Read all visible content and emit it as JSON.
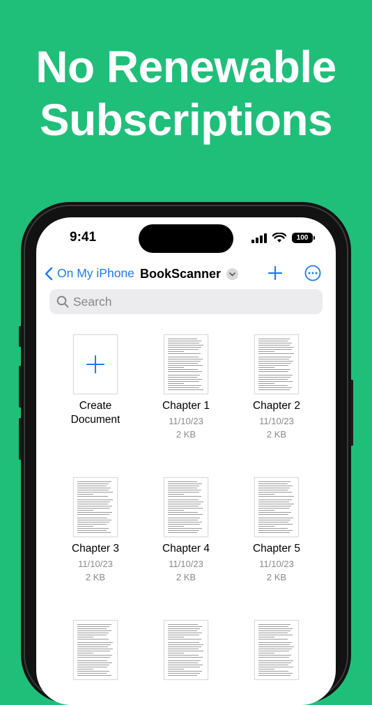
{
  "headline": {
    "line1": "No Renewable",
    "line2": "Subscriptions"
  },
  "status_bar": {
    "time": "9:41",
    "battery": "100"
  },
  "nav": {
    "back_label": "On My iPhone",
    "title": "BookScanner"
  },
  "search": {
    "placeholder": "Search"
  },
  "create": {
    "line1": "Create",
    "line2": "Document"
  },
  "files": [
    {
      "name": "Chapter 1",
      "date": "11/10/23",
      "size": "2 KB"
    },
    {
      "name": "Chapter 2",
      "date": "11/10/23",
      "size": "2 KB"
    },
    {
      "name": "Chapter 3",
      "date": "11/10/23",
      "size": "2 KB"
    },
    {
      "name": "Chapter 4",
      "date": "11/10/23",
      "size": "2 KB"
    },
    {
      "name": "Chapter 5",
      "date": "11/10/23",
      "size": "2 KB"
    }
  ],
  "colors": {
    "background": "#1fbf7a",
    "accent": "#1b7cf2"
  }
}
